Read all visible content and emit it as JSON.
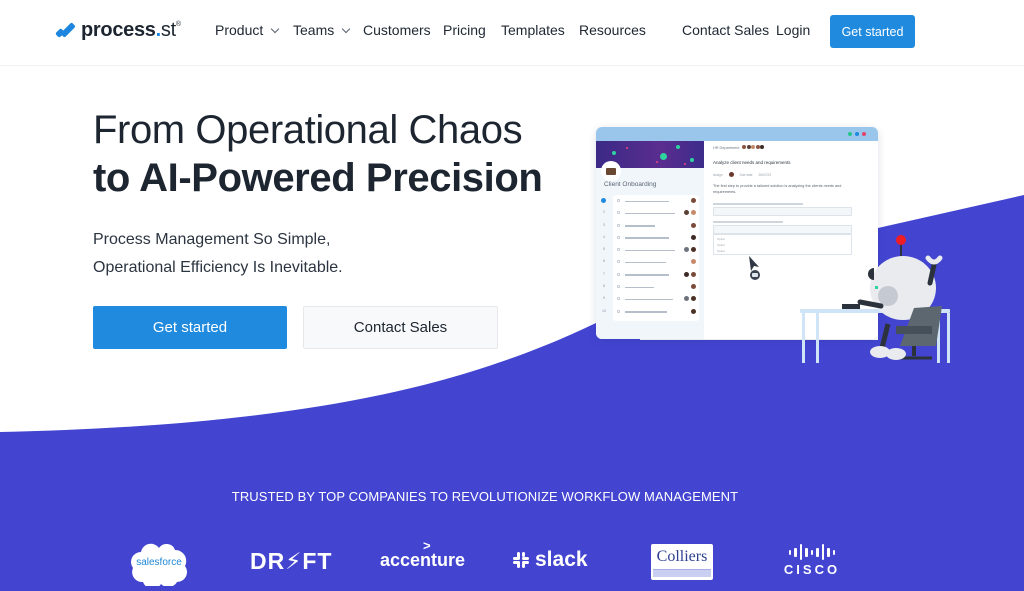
{
  "colors": {
    "brand_blue": "#1f8ade",
    "hero_purple": "#4345d1",
    "text_dark": "#1c2530",
    "robot_antenna_red": "#ee1c24"
  },
  "nav": {
    "logo": {
      "name": "process",
      "dot": ".",
      "suffix": "st",
      "mark": "®"
    },
    "items": [
      {
        "label": "Product",
        "has_dropdown": true
      },
      {
        "label": "Teams",
        "has_dropdown": true
      },
      {
        "label": "Customers",
        "has_dropdown": false
      },
      {
        "label": "Pricing",
        "has_dropdown": false
      },
      {
        "label": "Templates",
        "has_dropdown": false
      },
      {
        "label": "Resources",
        "has_dropdown": false
      }
    ],
    "contact_sales": "Contact Sales",
    "login": "Login",
    "cta": "Get started"
  },
  "hero": {
    "title_line1": "From Operational Chaos",
    "title_line2": "to AI-Powered Precision",
    "subtitle_line1": "Process Management So Simple,",
    "subtitle_line2": "Operational Efficiency Is Inevitable.",
    "primary_button": "Get started",
    "secondary_button": "Contact Sales"
  },
  "mockup": {
    "sidebar_title": "Client Onboarding",
    "row_numbers": [
      "1",
      "2",
      "3",
      "4",
      "5",
      "6",
      "7",
      "8",
      "9",
      "10"
    ],
    "department": "HR Department",
    "task_title": "Analyze client needs and requirements",
    "assign_label": "Assign",
    "due_label": "Due date",
    "due_value": "26/07/23",
    "description": "The first step to provide a tailored solution is analyzing the clients needs and requirements.",
    "options": [
      "Option",
      "Option",
      "Option"
    ]
  },
  "trusted": {
    "heading": "TRUSTED BY TOP COMPANIES TO REVOLUTIONIZE WORKFLOW MANAGEMENT",
    "logos": [
      {
        "name": "salesforce",
        "text": "salesforce"
      },
      {
        "name": "drift",
        "text": "DR⚡FT"
      },
      {
        "name": "accenture",
        "text": "accenture",
        "accent": ">"
      },
      {
        "name": "slack",
        "text": "slack"
      },
      {
        "name": "colliers",
        "text": "Colliers"
      },
      {
        "name": "cisco",
        "text": "CISCO"
      }
    ]
  }
}
